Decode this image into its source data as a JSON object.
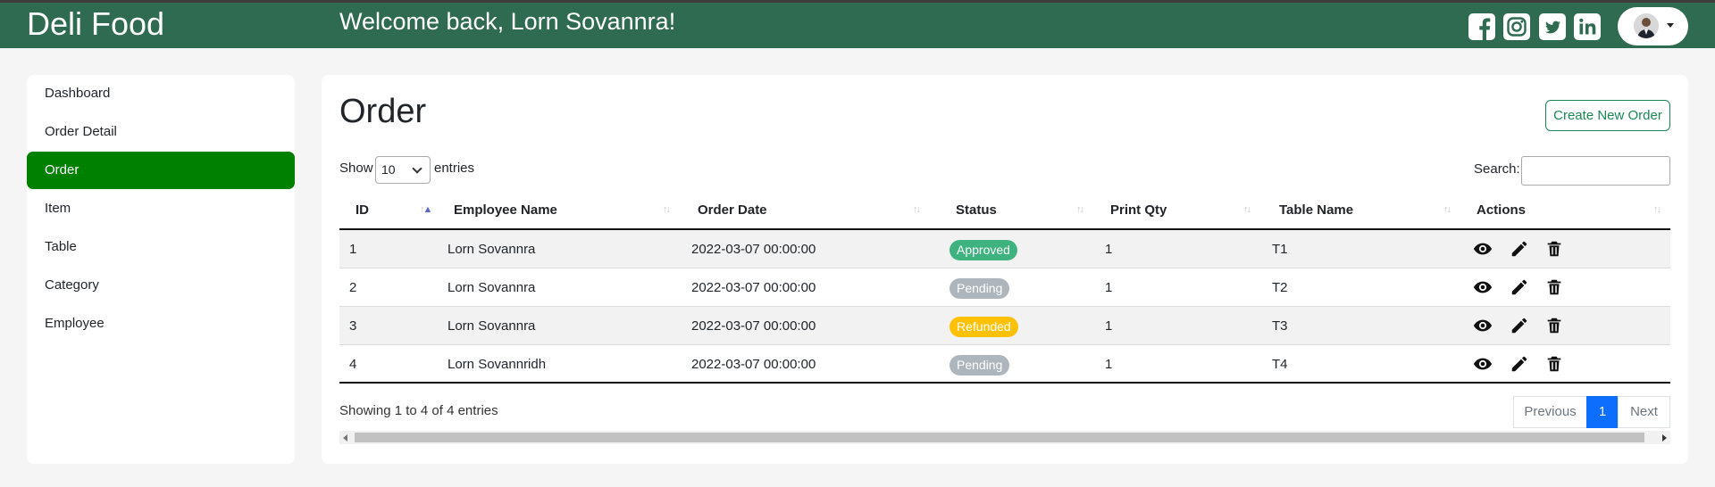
{
  "header": {
    "brand": "Deli Food",
    "welcome": "Welcome back, Lorn Sovannra!",
    "social_icons": [
      "facebook-icon",
      "instagram-icon",
      "twitter-icon",
      "linkedin-icon"
    ],
    "background_color": "#2f6b50"
  },
  "sidebar": {
    "items": [
      {
        "label": "Dashboard",
        "active": false
      },
      {
        "label": "Order Detail",
        "active": false
      },
      {
        "label": "Order",
        "active": true
      },
      {
        "label": "Item",
        "active": false
      },
      {
        "label": "Table",
        "active": false
      },
      {
        "label": "Category",
        "active": false
      },
      {
        "label": "Employee",
        "active": false
      }
    ],
    "active_color": "#008000"
  },
  "main": {
    "title": "Order",
    "create_button": "Create New Order",
    "show_label": "Show",
    "entries_value": "10",
    "entries_label": "entries",
    "search_label": "Search:",
    "search_value": "",
    "columns": [
      "ID",
      "Employee Name",
      "Order Date",
      "Status",
      "Print Qty",
      "Table Name",
      "Actions"
    ],
    "rows": [
      {
        "id": "1",
        "employee": "Lorn Sovannra",
        "date": "2022-03-07 00:00:00",
        "status": "Approved",
        "qty": "1",
        "table": "T1"
      },
      {
        "id": "2",
        "employee": "Lorn Sovannra",
        "date": "2022-03-07 00:00:00",
        "status": "Pending",
        "qty": "1",
        "table": "T2"
      },
      {
        "id": "3",
        "employee": "Lorn Sovannra",
        "date": "2022-03-07 00:00:00",
        "status": "Refunded",
        "qty": "1",
        "table": "T3"
      },
      {
        "id": "4",
        "employee": "Lorn Sovannridh",
        "date": "2022-03-07 00:00:00",
        "status": "Pending",
        "qty": "1",
        "table": "T4"
      }
    ],
    "status_colors": {
      "Approved": "#3fb37f",
      "Pending": "#adb5bd",
      "Refunded": "#ffc107"
    },
    "action_icons": [
      "eye-icon",
      "pencil-icon",
      "trash-icon"
    ],
    "info": "Showing 1 to 4 of 4 entries",
    "pagination": {
      "previous": "Previous",
      "current": "1",
      "next": "Next"
    }
  }
}
